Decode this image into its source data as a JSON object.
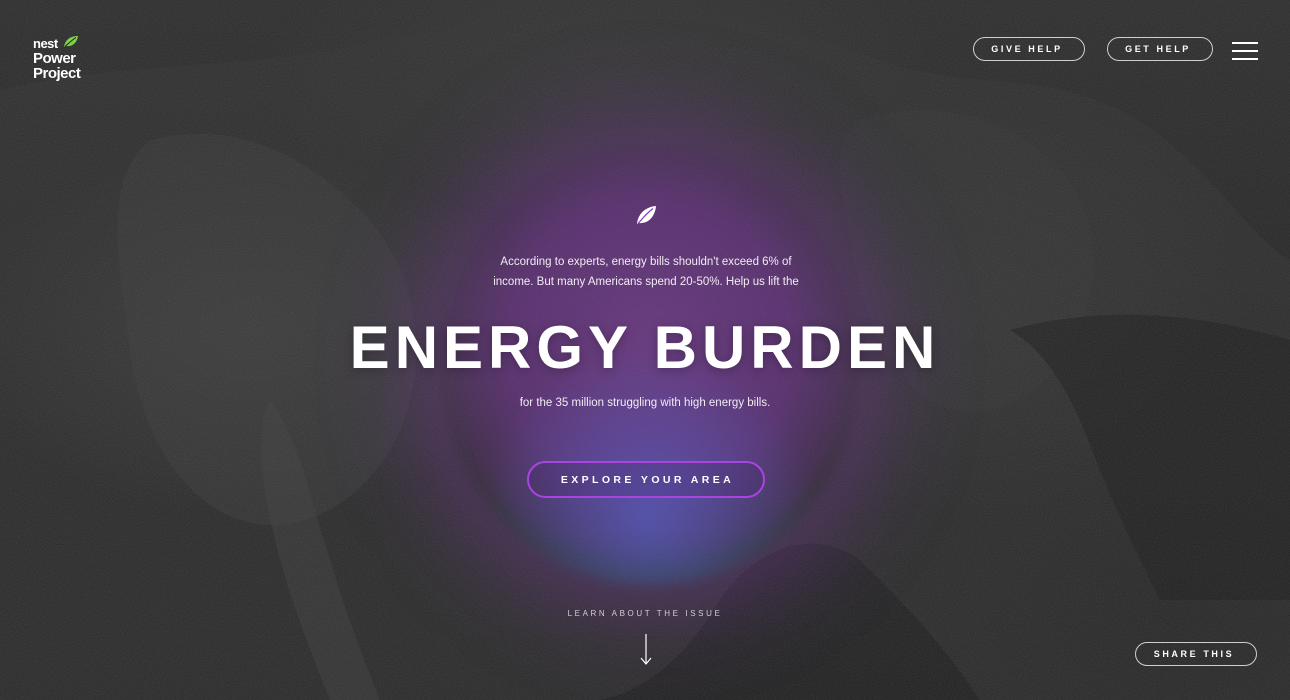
{
  "header": {
    "logo": {
      "line1": "nest",
      "line2": "Power",
      "line3": "Project"
    },
    "give_help_label": "GIVE HELP",
    "get_help_label": "GET HELP",
    "menu_icon": "hamburger-menu-icon"
  },
  "hero": {
    "icon": "leaf-icon",
    "intro_line1": "According to experts, energy bills shouldn't exceed 6% of",
    "intro_line2": "income. But many Americans spend 20-50%. Help us lift the",
    "title": "ENERGY BURDEN",
    "subtitle": "for the 35 million struggling with high energy bills.",
    "cta_label": "EXPLORE YOUR AREA"
  },
  "footer": {
    "learn_label": "LEARN ABOUT THE ISSUE",
    "arrow_icon": "arrow-down-icon",
    "share_label": "SHARE THIS"
  },
  "colors": {
    "background": "#1c1c1d",
    "glow": "#8a3fb8",
    "cta_border": "#a844e0",
    "logo_leaf": "#7fd24a",
    "text": "#ffffff"
  }
}
